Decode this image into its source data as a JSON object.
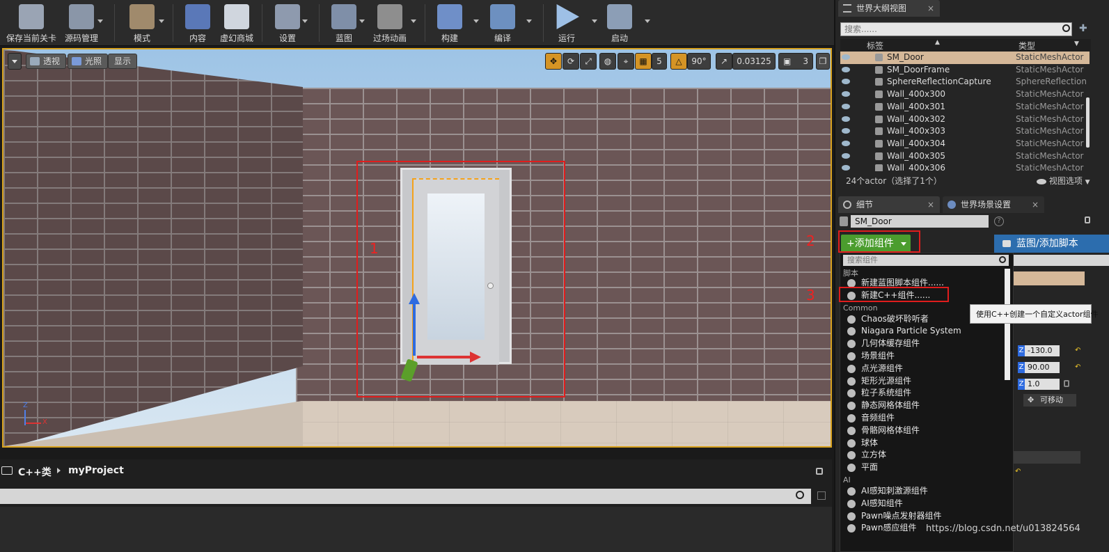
{
  "toolbar": {
    "buttons": [
      {
        "label": "保存当前关卡",
        "icon": "save-icon",
        "color": "#9aa4b4"
      },
      {
        "label": "源码管理",
        "icon": "source-control-icon",
        "color": "#8a96a8"
      },
      {
        "label": "模式",
        "icon": "modes-icon",
        "color": "#a08a6c"
      },
      {
        "label": "内容",
        "icon": "content-icon",
        "color": "#5a78b8"
      },
      {
        "label": "虚幻商城",
        "icon": "marketplace-icon",
        "color": "#d0d6de"
      },
      {
        "label": "设置",
        "icon": "settings-icon",
        "color": "#8e9aae"
      },
      {
        "label": "蓝图",
        "icon": "blueprint-icon",
        "color": "#7f8fa8"
      },
      {
        "label": "过场动画",
        "icon": "cinematics-icon",
        "color": "#8e8e8e"
      },
      {
        "label": "构建",
        "icon": "build-icon",
        "color": "#6f8fc8"
      },
      {
        "label": "编译",
        "icon": "compile-icon",
        "color": "#6d90c0"
      },
      {
        "label": "运行",
        "icon": "play-icon",
        "color": "#9ec0e6"
      },
      {
        "label": "启动",
        "icon": "launch-icon",
        "color": "#8c9eb6"
      }
    ]
  },
  "viewport": {
    "perspective_label": "透视",
    "lit_label": "光照",
    "show_label": "显示",
    "grid_snap": "5",
    "rotation_snap": "90°",
    "scale_snap": "0.03125",
    "camera_speed": "3",
    "axis_z": "Z",
    "axis_x": "X",
    "annotation_1": "1"
  },
  "content_browser": {
    "root": "C++类",
    "folder": "myProject"
  },
  "outliner": {
    "tab_title": "世界大纲视图",
    "search_placeholder": "搜索......",
    "col_label": "标签",
    "col_type": "类型",
    "rows": [
      {
        "name": "SM_Door",
        "type": "StaticMeshActor",
        "selected": true
      },
      {
        "name": "SM_DoorFrame",
        "type": "StaticMeshActor"
      },
      {
        "name": "SphereReflectionCapture",
        "type": "SphereReflection"
      },
      {
        "name": "Wall_400x300",
        "type": "StaticMeshActor"
      },
      {
        "name": "Wall_400x301",
        "type": "StaticMeshActor"
      },
      {
        "name": "Wall_400x302",
        "type": "StaticMeshActor"
      },
      {
        "name": "Wall_400x303",
        "type": "StaticMeshActor"
      },
      {
        "name": "Wall_400x304",
        "type": "StaticMeshActor"
      },
      {
        "name": "Wall_400x305",
        "type": "StaticMeshActor"
      },
      {
        "name": "Wall_400x306",
        "type": "StaticMeshActor"
      }
    ],
    "status": "24个actor（选择了1个）",
    "view_options": "视图选项"
  },
  "details": {
    "tab_details": "细节",
    "tab_world": "世界场景设置",
    "actor_name": "SM_Door",
    "add_component": "+添加组件",
    "blueprint_script": "蓝图/添加脚本",
    "annotation_2": "2",
    "annotation_3": "3",
    "z_fields": [
      "-130.0",
      "90.00",
      "1.0"
    ],
    "z_label": "Z",
    "movable": "可移动"
  },
  "component_menu": {
    "search_placeholder": "搜索组件",
    "cat_script": "脚本",
    "script_items": [
      "新建蓝图脚本组件......",
      "新建C++组件......"
    ],
    "cat_common": "Common",
    "common_items": [
      "Chaos破坏聆听者",
      "Niagara Particle System",
      "几何体缓存组件",
      "场景组件",
      "点光源组件",
      "矩形光源组件",
      "粒子系统组件",
      "静态网格体组件",
      "音频组件",
      "骨骼网格体组件",
      "球体",
      "立方体",
      "平面"
    ],
    "cat_ai": "AI",
    "ai_items": [
      "AI感知刺激源组件",
      "AI感知组件",
      "Pawn噪点发射器组件",
      "Pawn感应组件"
    ],
    "tooltip": "使用C++创建一个自定义actor组件"
  },
  "watermark": "https://blog.csdn.net/u013824564"
}
